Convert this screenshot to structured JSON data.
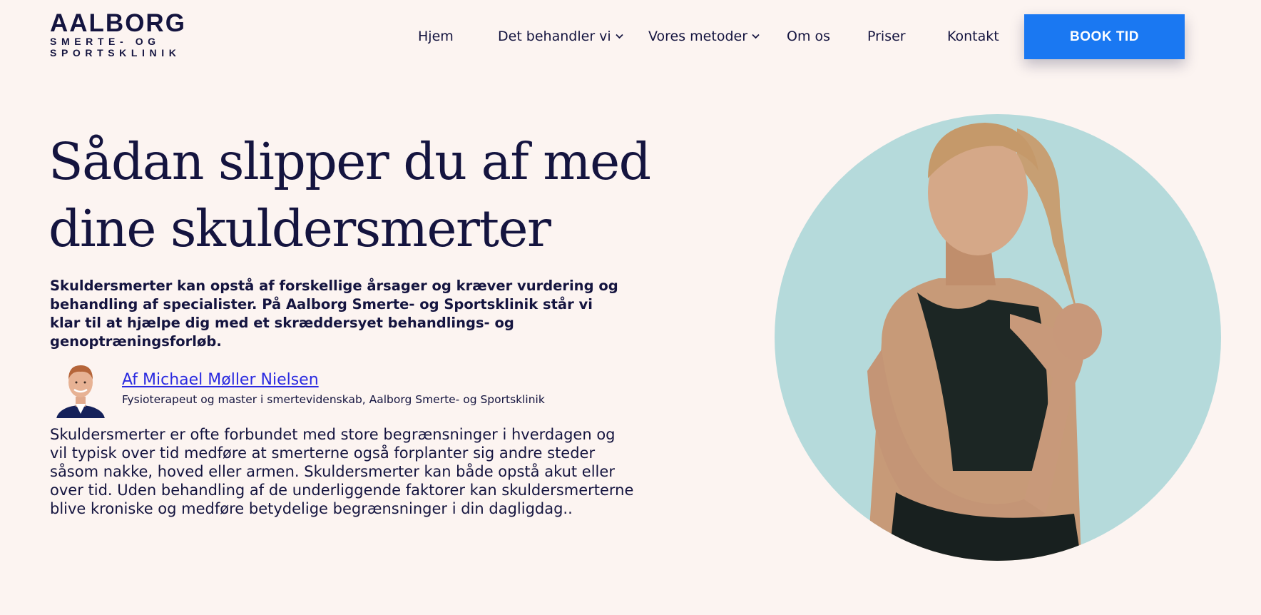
{
  "logo": {
    "main": "AALBORG",
    "line2": "SMERTE- OG",
    "line3": "SPORTSKLINIK"
  },
  "nav": {
    "items": [
      {
        "label": "Hjem",
        "dropdown": false
      },
      {
        "label": "Det behandler vi",
        "dropdown": true
      },
      {
        "label": "Vores metoder",
        "dropdown": true
      },
      {
        "label": "Om os",
        "dropdown": false
      },
      {
        "label": "Priser",
        "dropdown": false
      },
      {
        "label": "Kontakt",
        "dropdown": false
      }
    ],
    "cta": "BOOK TID"
  },
  "hero": {
    "title_line1": "Sådan slipper du af med",
    "title_line2": "dine skuldersmerter",
    "lead": "Skuldersmerter kan opstå af forskellige årsager og kræver vurdering og behandling af specialister. På Aalborg Smerte- og Sportsklinik står vi klar til at hjælpe dig med et skræddersyet behandlings- og genoptræningsforløb.",
    "author_name": "Af Michael Møller Nielsen",
    "author_role": "Fysioterapeut og master i smertevidenskab, Aalborg Smerte- og Sportsklinik",
    "body": "Skuldersmerter er ofte forbundet med store begrænsninger i hverdagen og vil typisk over tid medføre at smerterne også forplanter sig andre steder såsom nakke, hoved eller armen. Skuldersmerter kan både opstå akut eller over tid. Uden behandling af de underliggende faktorer kan skuldersmerterne blive kroniske og medføre betydelige begrænsninger i din dagligdag.."
  },
  "colors": {
    "background": "#fcf4f1",
    "navy": "#14143f",
    "cta": "#1a78f2",
    "circle": "#b5dadb",
    "link": "#2a2ae0"
  },
  "icons": [
    "chevron-down-icon",
    "author-avatar",
    "woman-photo"
  ]
}
